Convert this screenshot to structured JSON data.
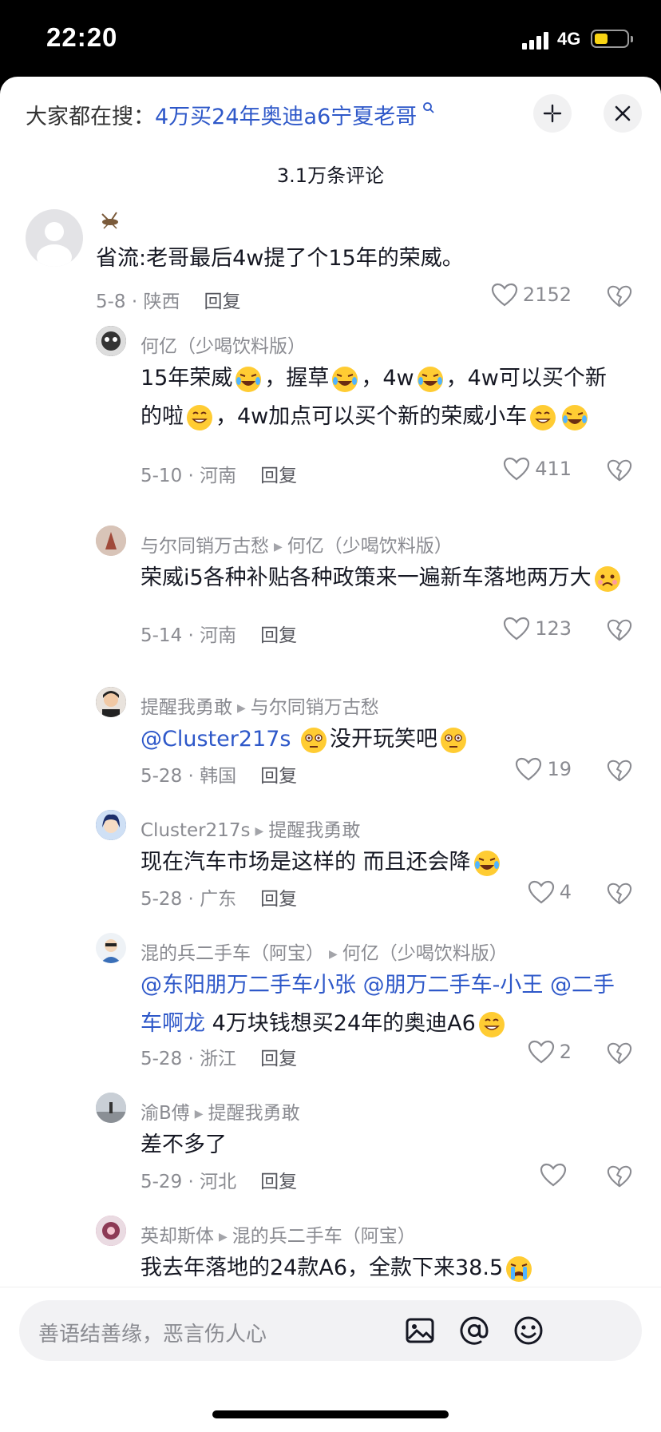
{
  "status": {
    "time": "22:20",
    "network": "4G"
  },
  "header": {
    "search_prefix": "大家都在搜：",
    "search_term": "4万买24年奥迪a6宁夏老哥",
    "comment_count": "3.1万条评论"
  },
  "comments": [
    {
      "user": "",
      "text": "省流:老哥最后4w提了个15年的荣威。",
      "date": "5-8 · 陕西",
      "likes": "2152"
    },
    {
      "user": "何亿（少喝饮料版）",
      "text_parts": [
        "15年荣威",
        "，握草",
        "，4w",
        "，4w可以买个新的啦",
        "，4w加点可以买个新的荣威小车"
      ],
      "date": "5-10 · 河南",
      "likes": "411"
    },
    {
      "user": "与尔同销万古愁",
      "reply_to": "何亿（少喝饮料版）",
      "text": "荣威i5各种补贴各种政策来一遍新车落地两万大",
      "date": "5-14 · 河南",
      "likes": "123"
    },
    {
      "user": "提醒我勇敢",
      "reply_to": "与尔同销万古愁",
      "mention": "@Cluster217s",
      "text": "没开玩笑吧",
      "date": "5-28 · 韩国",
      "likes": "19"
    },
    {
      "user": "Cluster217s",
      "reply_to": "提醒我勇敢",
      "text": "现在汽车市场是这样的 而且还会降",
      "date": "5-28 · 广东",
      "likes": "4"
    },
    {
      "user": "混的兵二手车（阿宝）",
      "reply_to": "何亿（少喝饮料版）",
      "mention1": "@东阳朋万二手车小张",
      "mention2": "@朋万二手车-小王",
      "mention3": "@二手车啊龙",
      "text": "4万块钱想买24年的奥迪A6",
      "date": "5-28 · 浙江",
      "likes": "2"
    },
    {
      "user": "渝B傅",
      "reply_to": "提醒我勇敢",
      "text": "差不多了",
      "date": "5-29 · 河北",
      "likes": ""
    },
    {
      "user": "英却斯体",
      "reply_to": "混的兵二手车（阿宝）",
      "text": "我去年落地的24款A6，全款下来38.5"
    }
  ],
  "ui": {
    "reply_label": "回复",
    "input_placeholder": "善语结善缘，恶言伤人心"
  },
  "colors": {
    "accent": "#2e58c9",
    "battery": "#f8d414"
  }
}
